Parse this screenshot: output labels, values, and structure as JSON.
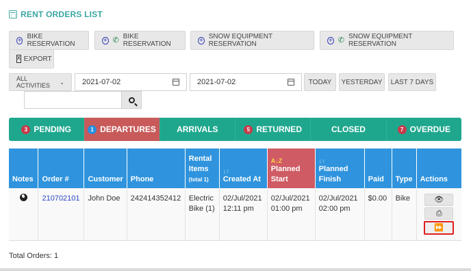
{
  "page": {
    "title": "RENT ORDERS LIST"
  },
  "toolbar": {
    "bike_reservation": "BIKE RESERVATION",
    "bike_reservation_phone": "BIKE RESERVATION",
    "snow_reservation": "SNOW EQUIPMENT RESERVATION",
    "snow_reservation_phone": "SNOW EQUIPMENT RESERVATION",
    "export": "EXPORT"
  },
  "filters": {
    "activity": "ALL ACTIVITIES",
    "date_from": "2021-07-02",
    "date_to": "2021-07-02",
    "today": "TODAY",
    "yesterday": "YESTERDAY",
    "last7": "LAST 7 DAYS",
    "search_value": ""
  },
  "tabs": [
    {
      "label": "PENDING",
      "count": "3"
    },
    {
      "label": "DEPARTURES",
      "count": "1"
    },
    {
      "label": "ARRIVALS",
      "count": ""
    },
    {
      "label": "RETURNED",
      "count": "5"
    },
    {
      "label": "CLOSED",
      "count": ""
    },
    {
      "label": "OVERDUE",
      "count": "7"
    }
  ],
  "table": {
    "headers": {
      "notes": "Notes",
      "order": "Order #",
      "customer": "Customer",
      "phone": "Phone",
      "rental_items_line1": "Rental",
      "rental_items_line2": "Items",
      "rental_items_total": "(total 1)",
      "created_line1": "Created At",
      "planned_start_line1": "Planned",
      "planned_start_line2": "Start",
      "planned_finish_line1": "Planned",
      "planned_finish_line2": "Finish",
      "paid": "Paid",
      "type": "Type",
      "actions": "Actions"
    },
    "rows": [
      {
        "order": "210702101",
        "customer": "John Doe",
        "phone": "242414352412",
        "item_line1": "Electric",
        "item_line2": "Bike (1)",
        "created_date": "02/Jul/2021",
        "created_time": "12:11 pm",
        "start_date": "02/Jul/2021",
        "start_time": "01:00 pm",
        "finish_date": "02/Jul/2021",
        "finish_time": "02:00 pm",
        "paid": "$0.00",
        "type": "Bike"
      }
    ]
  },
  "footer": {
    "total": "Total Orders: 1"
  },
  "colors": {
    "teal": "#1fa78e",
    "header_blue": "#2f94dd",
    "active_red": "#c85a5a",
    "highlight": "#e01e1e"
  }
}
